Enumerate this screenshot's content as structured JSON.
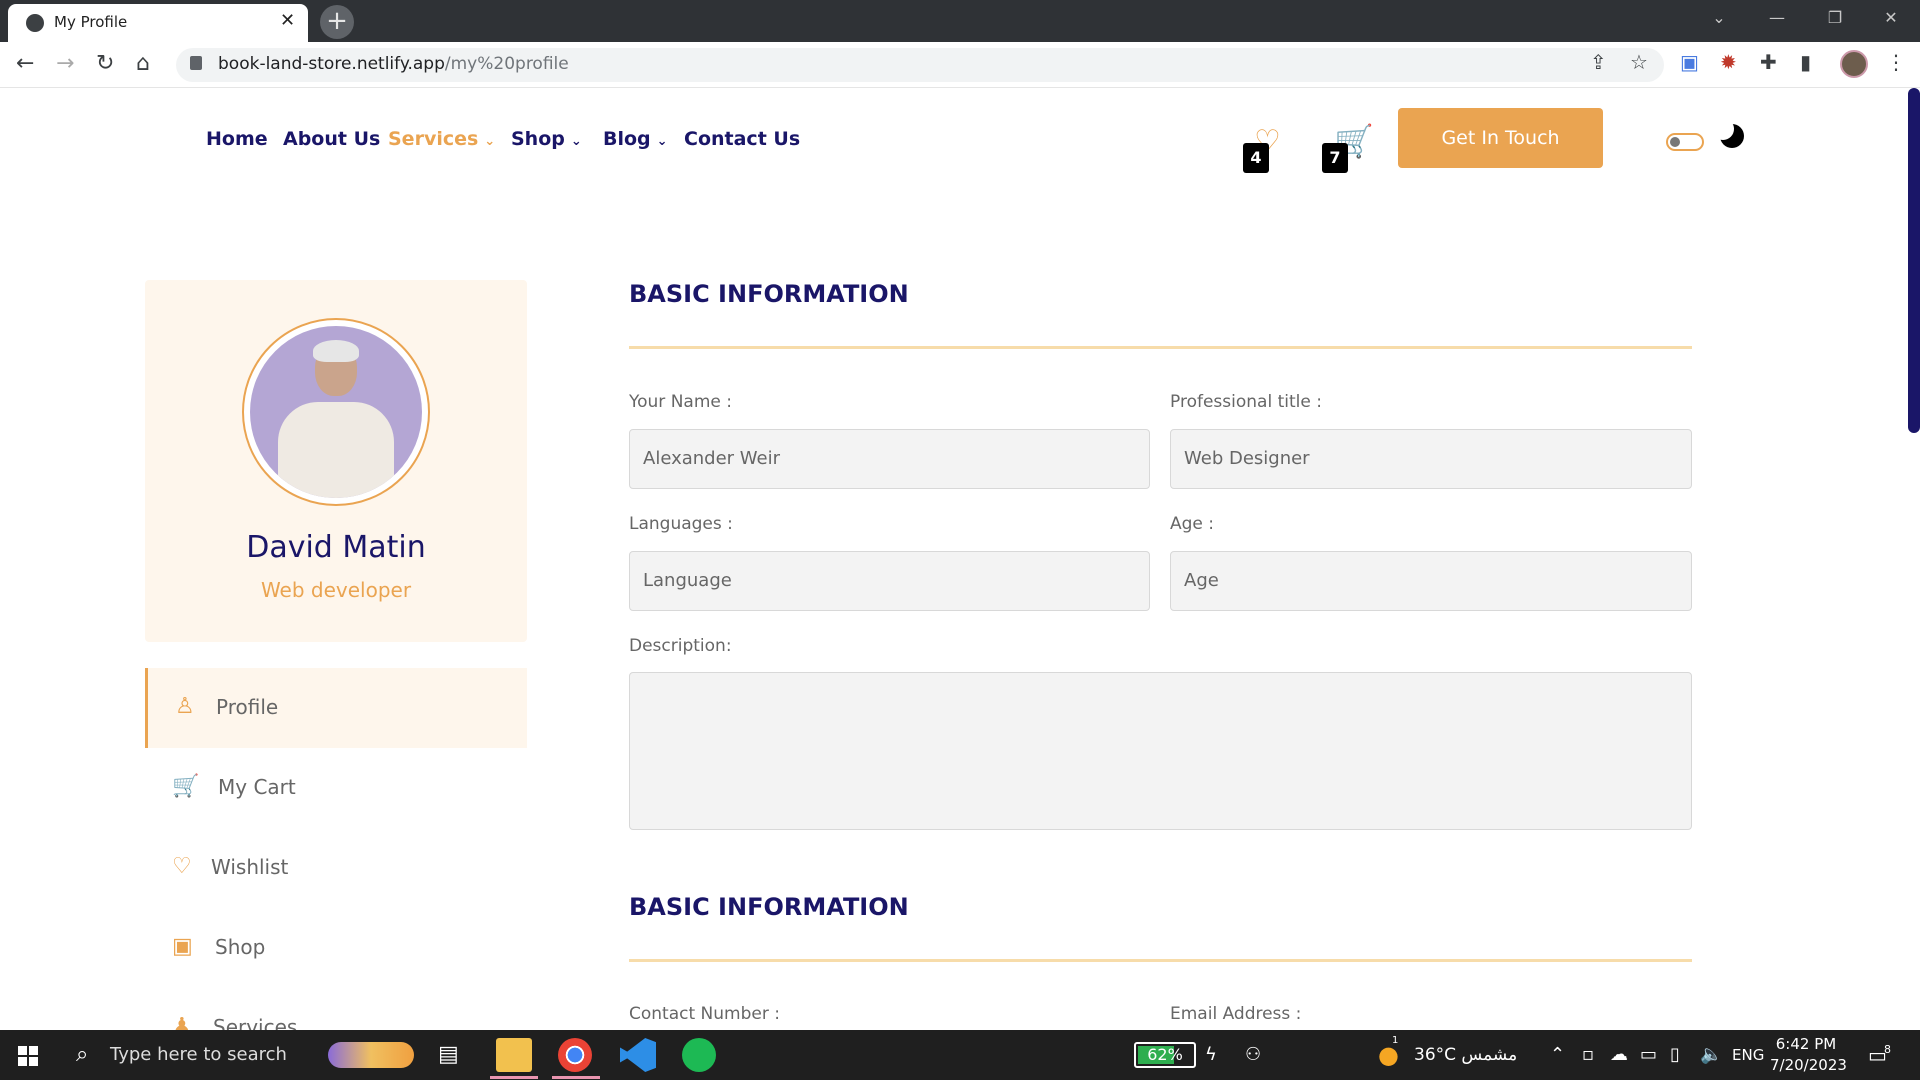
{
  "browser": {
    "tab_title": "My Profile",
    "tab_close": "✕",
    "new_tab": "+",
    "window_controls": {
      "tabs": "⌄",
      "minimize": "—",
      "restore": "❐",
      "close": "✕"
    },
    "url_host": "book-land-store.netlify.app",
    "url_path": "/my%20profile"
  },
  "header": {
    "menu": [
      {
        "label": "Home",
        "caret": ""
      },
      {
        "label": "About Us",
        "caret": ""
      },
      {
        "label": "Services",
        "caret": "⌄"
      },
      {
        "label": "Shop",
        "caret": "⌄"
      },
      {
        "label": "Blog",
        "caret": "⌄"
      },
      {
        "label": "Contact Us",
        "caret": ""
      }
    ],
    "wishlist_count": "4",
    "cart_count": "7",
    "cta_label": "Get In Touch",
    "accent_color": "#eaa451",
    "navy_color": "#1a1668"
  },
  "profile": {
    "name": "David Matin",
    "role": "Web developer"
  },
  "sidebar": {
    "items": [
      {
        "label": "Profile",
        "icon": "user-icon"
      },
      {
        "label": "My Cart",
        "icon": "cart-icon"
      },
      {
        "label": "Wishlist",
        "icon": "heart-icon"
      },
      {
        "label": "Shop",
        "icon": "briefcase-icon"
      },
      {
        "label": "Services",
        "icon": "bell-icon"
      }
    ]
  },
  "form": {
    "section1_title": "BASIC INFORMATION",
    "name_label": "Your Name :",
    "name_value": "Alexander Weir",
    "title_label": "Professional title :",
    "title_value": "Web Designer",
    "languages_label": "Languages :",
    "languages_placeholder": "Language",
    "age_label": "Age :",
    "age_placeholder": "Age",
    "description_label": "Description:",
    "section2_title": "BASIC INFORMATION",
    "contact_label": "Contact Number :",
    "email_label": "Email Address :"
  },
  "taskbar": {
    "search_placeholder": "Type here to search",
    "battery": "62%",
    "weather": "36°C مشمس",
    "weather_badge": "1",
    "language": "ENG",
    "time": "6:42 PM",
    "date": "7/20/2023",
    "notifications": "8"
  }
}
